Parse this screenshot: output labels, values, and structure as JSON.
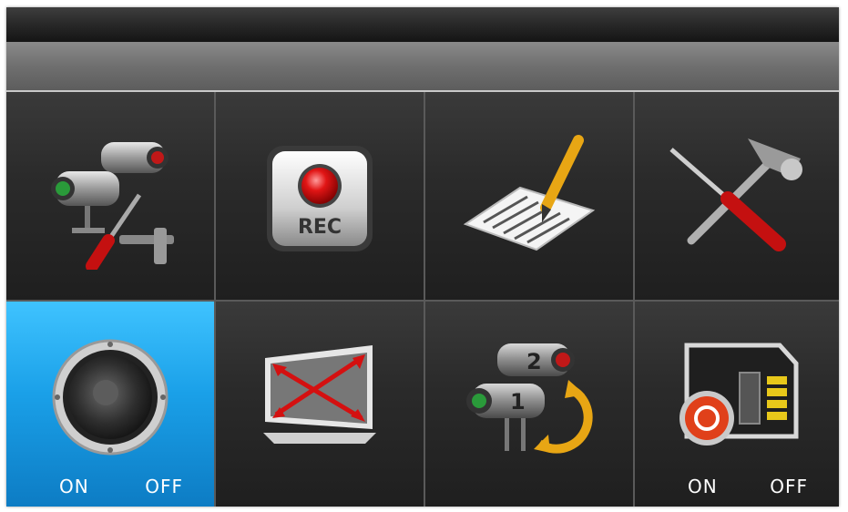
{
  "menu": {
    "tiles": [
      {
        "id": "camera-setup",
        "icon": "camera-tools-icon"
      },
      {
        "id": "record",
        "icon": "record-icon",
        "rec_label": "REC"
      },
      {
        "id": "event-list",
        "icon": "document-pen-icon"
      },
      {
        "id": "system-setup",
        "icon": "tools-icon"
      },
      {
        "id": "audio",
        "icon": "speaker-icon",
        "on_label": "ON",
        "off_label": "OFF",
        "selected": true
      },
      {
        "id": "display",
        "icon": "screen-resize-icon"
      },
      {
        "id": "camera-switch",
        "icon": "camera-switch-icon",
        "cam1_label": "1",
        "cam2_label": "2"
      },
      {
        "id": "sd-card",
        "icon": "sd-card-icon",
        "on_label": "ON",
        "off_label": "OFF"
      }
    ]
  },
  "colors": {
    "selected_tile": "#1aa0e8",
    "tile_bg": "#2b2b2b",
    "divider": "#5a5a5a"
  }
}
